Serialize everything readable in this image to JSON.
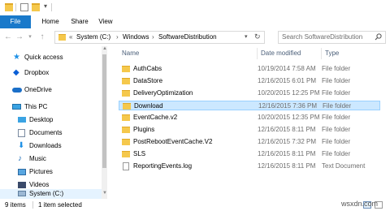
{
  "ribbon": {
    "tabs": [
      "File",
      "Home",
      "Share",
      "View"
    ]
  },
  "address": {
    "separator": "«",
    "crumbs": [
      "System (C:)",
      "Windows",
      "SoftwareDistribution"
    ],
    "crumb_sep": "›",
    "search_placeholder": "Search SoftwareDistribution"
  },
  "nav": {
    "items": [
      {
        "label": "Quick access",
        "icon": "star-icon"
      },
      {
        "label": "Dropbox",
        "icon": "dropbox-icon"
      },
      {
        "label": "OneDrive",
        "icon": "cloud-icon"
      },
      {
        "label": "This PC",
        "icon": "computer-icon"
      },
      {
        "label": "Desktop",
        "icon": "desktop-icon"
      },
      {
        "label": "Documents",
        "icon": "documents-icon"
      },
      {
        "label": "Downloads",
        "icon": "download-icon"
      },
      {
        "label": "Music",
        "icon": "music-icon"
      },
      {
        "label": "Pictures",
        "icon": "pictures-icon"
      },
      {
        "label": "Videos",
        "icon": "videos-icon"
      },
      {
        "label": "System (C:)",
        "icon": "drive-icon"
      }
    ]
  },
  "columns": {
    "name": "Name",
    "date": "Date modified",
    "type": "Type"
  },
  "files": [
    {
      "name": "AuthCabs",
      "date": "10/19/2014 7:58 AM",
      "type": "File folder"
    },
    {
      "name": "DataStore",
      "date": "12/16/2015 6:01 PM",
      "type": "File folder"
    },
    {
      "name": "DeliveryOptimization",
      "date": "10/20/2015 12:25 PM",
      "type": "File folder"
    },
    {
      "name": "Download",
      "date": "12/16/2015 7:36 PM",
      "type": "File folder"
    },
    {
      "name": "EventCache.v2",
      "date": "10/20/2015 12:35 PM",
      "type": "File folder"
    },
    {
      "name": "Plugins",
      "date": "12/16/2015 8:11 PM",
      "type": "File folder"
    },
    {
      "name": "PostRebootEventCache.V2",
      "date": "12/16/2015 7:32 PM",
      "type": "File folder"
    },
    {
      "name": "SLS",
      "date": "12/16/2015 8:11 PM",
      "type": "File folder"
    },
    {
      "name": "ReportingEvents.log",
      "date": "12/16/2015 8:11 PM",
      "type": "Text Document"
    }
  ],
  "status": {
    "count": "9 items",
    "selected": "1 item selected"
  },
  "watermark": "wsxdn.com",
  "colors": {
    "accent": "#1979ca",
    "selection": "#cce8ff",
    "folder": "#f5c84c"
  }
}
